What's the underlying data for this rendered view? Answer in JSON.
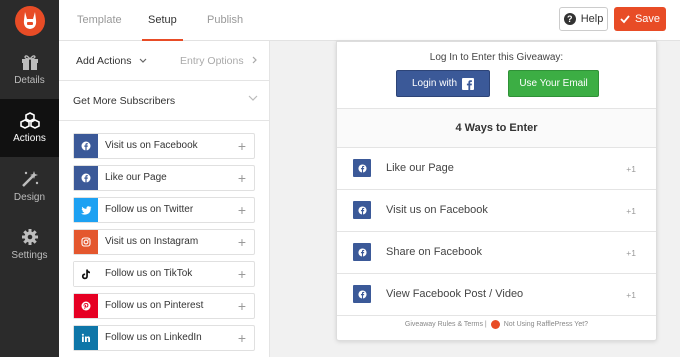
{
  "app": {
    "top_tabs": [
      {
        "label": "Template",
        "active": false
      },
      {
        "label": "Setup",
        "active": true
      },
      {
        "label": "Publish",
        "active": false
      }
    ],
    "help_label": "Help",
    "save_label": "Save",
    "accent_color": "#e84c26"
  },
  "sidebar": {
    "items": [
      {
        "label": "Details",
        "icon": "gift-icon",
        "active": false
      },
      {
        "label": "Actions",
        "icon": "cubes-icon",
        "active": true
      },
      {
        "label": "Design",
        "icon": "magic-wand-icon",
        "active": false
      },
      {
        "label": "Settings",
        "icon": "gear-icon",
        "active": false
      }
    ]
  },
  "panel": {
    "tab_add": "Add Actions",
    "tab_entry": "Entry Options",
    "section_title": "Get More Subscribers",
    "actions": [
      {
        "label": "Visit us on Facebook",
        "icon": "facebook-icon",
        "color": "#3b5998"
      },
      {
        "label": "Like our Page",
        "icon": "facebook-icon",
        "color": "#3b5998"
      },
      {
        "label": "Follow us on Twitter",
        "icon": "twitter-icon",
        "color": "#1da1f2"
      },
      {
        "label": "Visit us on Instagram",
        "icon": "instagram-icon",
        "color": "#e4572e"
      },
      {
        "label": "Follow us on TikTok",
        "icon": "tiktok-icon",
        "color": "#ffffff"
      },
      {
        "label": "Follow us on Pinterest",
        "icon": "pinterest-icon",
        "color": "#e60023"
      },
      {
        "label": "Follow us on LinkedIn",
        "icon": "linkedin-icon",
        "color": "#0e76a8"
      }
    ]
  },
  "preview": {
    "login_title": "Log In to Enter this Giveaway:",
    "login_facebook": "Login with",
    "login_email": "Use Your Email",
    "ways_title": "4 Ways to Enter",
    "entries": [
      {
        "label": "Like our Page",
        "points": "+1"
      },
      {
        "label": "Visit us on Facebook",
        "points": "+1"
      },
      {
        "label": "Share on Facebook",
        "points": "+1"
      },
      {
        "label": "View Facebook Post / Video",
        "points": "+1"
      }
    ],
    "footer_rules": "Giveaway Rules & Terms |",
    "footer_promo": "Not Using RafflePress Yet?"
  }
}
